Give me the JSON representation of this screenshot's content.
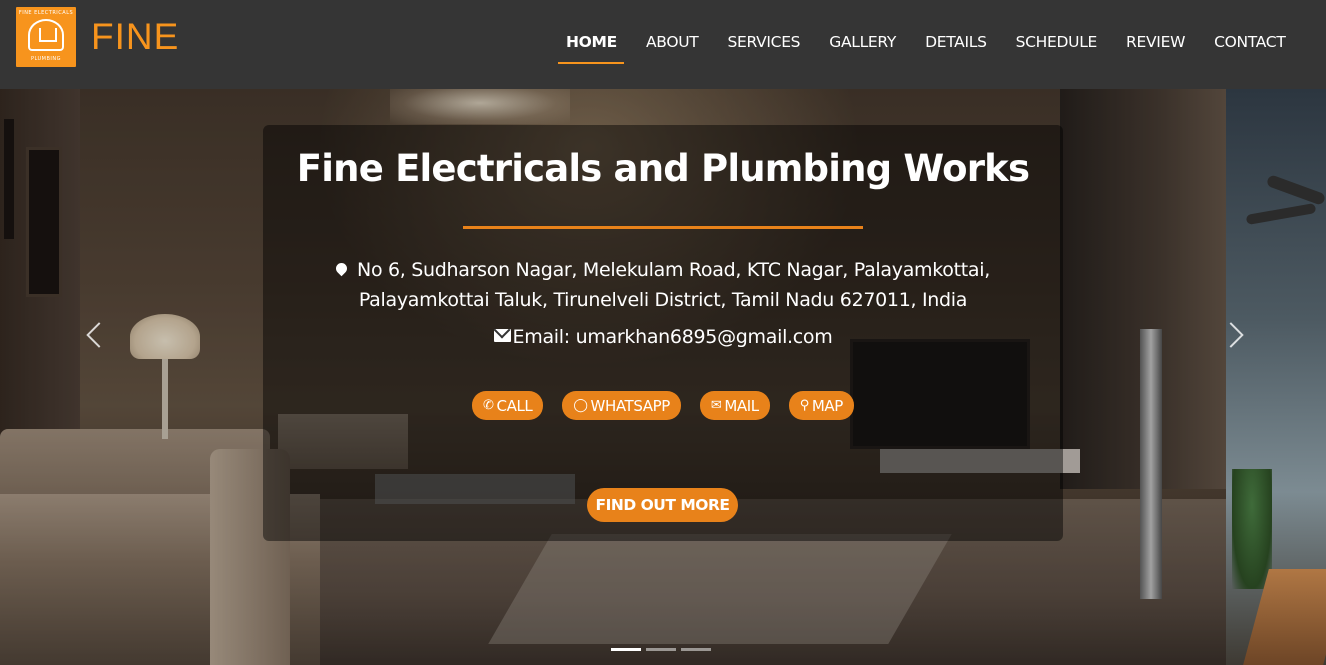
{
  "brand": {
    "logo_top_text": "FINE ELECTRICALS",
    "logo_bottom_text": "PLUMBING",
    "name": "FINE"
  },
  "nav": {
    "items": [
      {
        "label": "HOME",
        "active": true
      },
      {
        "label": "ABOUT",
        "active": false
      },
      {
        "label": "SERVICES",
        "active": false
      },
      {
        "label": "GALLERY",
        "active": false
      },
      {
        "label": "DETAILS",
        "active": false
      },
      {
        "label": "SCHEDULE",
        "active": false
      },
      {
        "label": "REVIEW",
        "active": false
      },
      {
        "label": "CONTACT",
        "active": false
      }
    ]
  },
  "hero": {
    "title": "Fine Electricals and Plumbing Works",
    "address_line1": "No 6, Sudharson Nagar, Melekulam Road, KTC Nagar, Palayamkottai,",
    "address_line2": "Palayamkottai Taluk, Tirunelveli District, Tamil Nadu 627011, India",
    "email": "Email: umarkhan6895@gmail.com",
    "actions": [
      {
        "label": "CALL",
        "icon": "phone-icon"
      },
      {
        "label": "WHATSAPP",
        "icon": "whatsapp-icon"
      },
      {
        "label": "MAIL",
        "icon": "mail-icon"
      },
      {
        "label": "MAP",
        "icon": "map-pin-icon"
      }
    ],
    "cta": "FIND OUT MORE"
  },
  "carousel": {
    "slide_count": 3,
    "active_index": 0
  },
  "colors": {
    "accent": "#e8821a",
    "navbar": "#353535",
    "brand": "#f7941d"
  }
}
